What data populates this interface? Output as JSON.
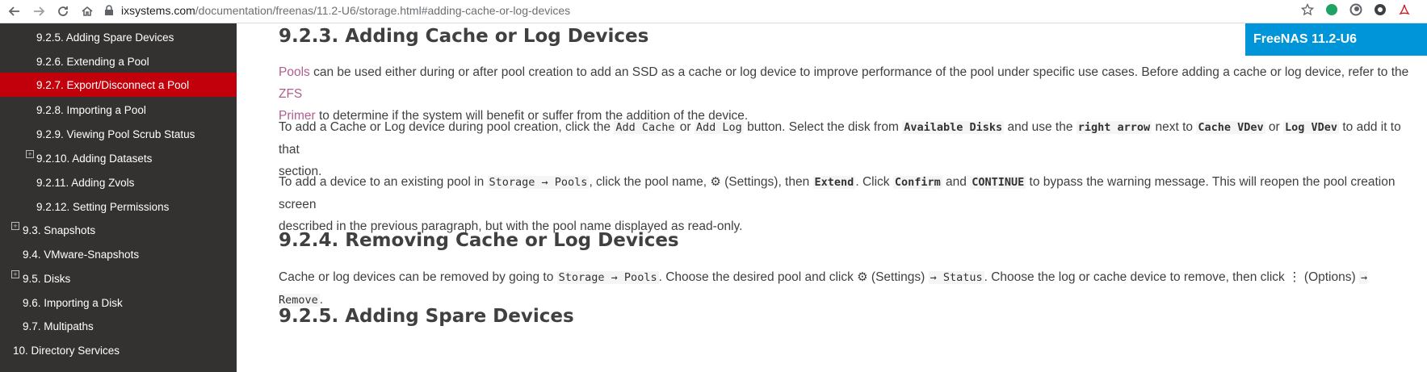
{
  "browser": {
    "host": "ixsystems.com",
    "path": "/documentation/freenas/11.2-U6/storage.html#adding-cache-or-log-devices"
  },
  "badge": "FreeNAS 11.2-U6",
  "sidebar": {
    "items": [
      {
        "label": "9.2.5. Adding Spare Devices"
      },
      {
        "label": "9.2.6. Extending a Pool"
      },
      {
        "label": "9.2.7. Export/Disconnect a Pool"
      },
      {
        "label": "9.2.8. Importing a Pool"
      },
      {
        "label": "9.2.9. Viewing Pool Scrub Status"
      },
      {
        "label": "9.2.10. Adding Datasets"
      },
      {
        "label": "9.2.11. Adding Zvols"
      },
      {
        "label": "9.2.12. Setting Permissions"
      },
      {
        "label": "9.3. Snapshots"
      },
      {
        "label": "9.4. VMware-Snapshots"
      },
      {
        "label": "9.5. Disks"
      },
      {
        "label": "9.6. Importing a Disk"
      },
      {
        "label": "9.7. Multipaths"
      },
      {
        "label": "10. Directory Services"
      }
    ]
  },
  "content": {
    "h1": "9.2.3. Adding Cache or Log Devices",
    "p1": {
      "link1": "Pools",
      "t1": " can be used either during or after pool creation to add an SSD as a cache or log device to improve performance of the pool under specific use cases. Before adding a cache or log device, refer to the ",
      "link2a": "ZFS",
      "link2b": "Primer",
      "t2": " to determine if the system will benefit or suffer from the addition of the device."
    },
    "p2": {
      "t1": "To add a Cache or Log device during pool creation, click the ",
      "c1": "Add Cache",
      "t2": " or ",
      "c2": "Add Log",
      "t3": " button. Select the disk from ",
      "c3": "Available Disks",
      "t4": " and use the ",
      "c4": "right arrow",
      "t5": " next to ",
      "c5": "Cache VDev",
      "t6": " or ",
      "c6": "Log VDev",
      "t7": " to add it to that",
      "line2": "section."
    },
    "p3": {
      "t1": "To add a device to an existing pool in ",
      "c1": "Storage → Pools",
      "t2": ", click the pool name, ",
      "gear": "⚙",
      "t3": " (Settings), then ",
      "c2": "Extend",
      "t4": ". Click ",
      "c3": "Confirm",
      "t5": " and ",
      "c4": "CONTINUE",
      "t6": " to bypass the warning message. This will reopen the pool creation screen",
      "line2": "described in the previous paragraph, but with the pool name displayed as read-only."
    },
    "h2": "9.2.4. Removing Cache or Log Devices",
    "p4": {
      "t1": "Cache or log devices can be removed by going to ",
      "c1": "Storage → Pools",
      "t2": ". Choose the desired pool and click ",
      "gear": "⚙",
      "t3": " (Settings) ",
      "c2": "→ Status",
      "t4": ". Choose the log or cache device to remove, then click ",
      "dots": "⋮",
      "t5": " (Options) ",
      "c3": "→ Remove",
      "t6": "."
    },
    "h3": "9.2.5. Adding Spare Devices"
  }
}
